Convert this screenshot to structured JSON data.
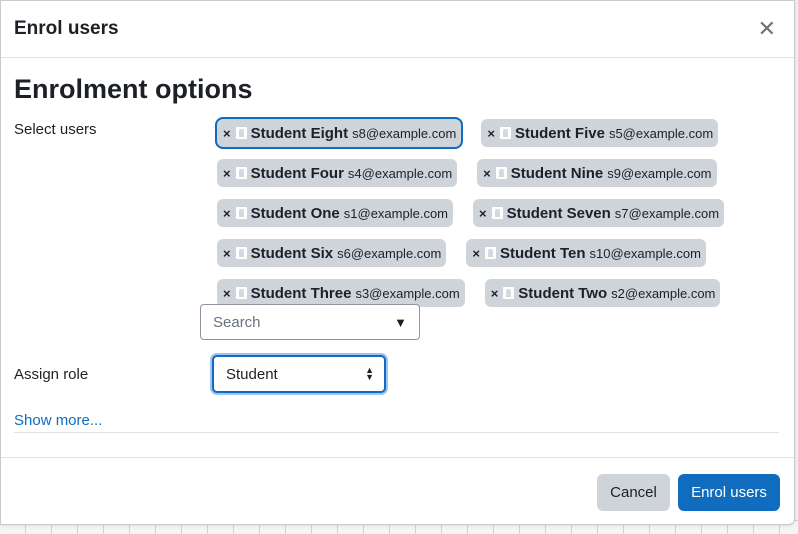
{
  "dialog": {
    "title": "Enrol users",
    "close_icon": "close-icon"
  },
  "section_title": "Enrolment options",
  "select_users": {
    "label": "Select users",
    "selected": [
      {
        "name": "Student Eight",
        "email": "s8@example.com",
        "focused": true
      },
      {
        "name": "Student Five",
        "email": "s5@example.com"
      },
      {
        "name": "Student Four",
        "email": "s4@example.com"
      },
      {
        "name": "Student Nine",
        "email": "s9@example.com"
      },
      {
        "name": "Student One",
        "email": "s1@example.com"
      },
      {
        "name": "Student Seven",
        "email": "s7@example.com"
      },
      {
        "name": "Student Six",
        "email": "s6@example.com"
      },
      {
        "name": "Student Ten",
        "email": "s10@example.com"
      },
      {
        "name": "Student Three",
        "email": "s3@example.com"
      },
      {
        "name": "Student Two",
        "email": "s2@example.com"
      }
    ],
    "remove_glyph": "×",
    "search_placeholder": "Search",
    "dropdown_glyph": "▼"
  },
  "assign_role": {
    "label": "Assign role",
    "selected": "Student"
  },
  "show_more": "Show more...",
  "footer": {
    "cancel_label": "Cancel",
    "submit_label": "Enrol users"
  },
  "colors": {
    "primary": "#0f6cbf",
    "chip_bg": "#ced4da"
  }
}
